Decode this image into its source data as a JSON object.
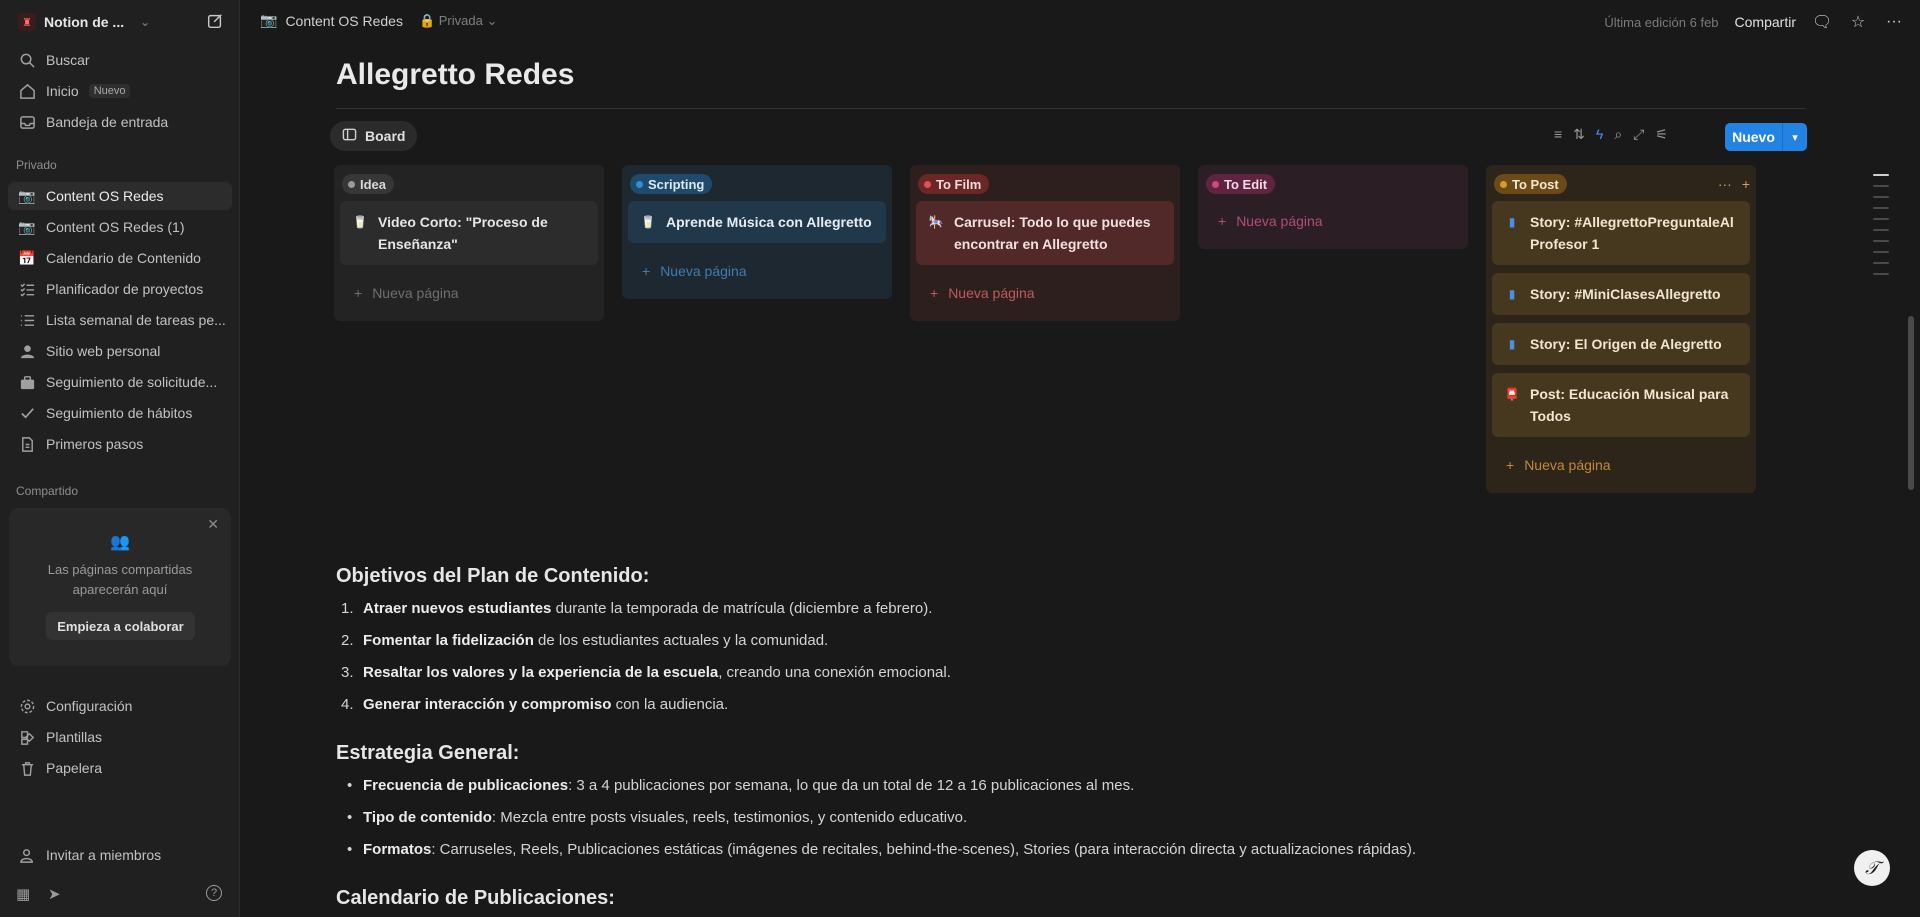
{
  "workspace": {
    "name": "Notion de ...",
    "avatar_glyph": "♜"
  },
  "sidebar": {
    "search": "Buscar",
    "home": "Inicio",
    "home_badge": "Nuevo",
    "inbox": "Bandeja de entrada",
    "private_label": "Privado",
    "private_items": [
      {
        "label": "Content OS Redes",
        "icon": "camera-icon"
      },
      {
        "label": "Content OS Redes (1)",
        "icon": "camera-icon"
      },
      {
        "label": "Calendario de Contenido",
        "icon": "calendar-icon"
      },
      {
        "label": "Planificador de proyectos",
        "icon": "checklist-icon"
      },
      {
        "label": "Lista semanal de tareas pe...",
        "icon": "list-icon"
      },
      {
        "label": "Sitio web personal",
        "icon": "person-icon"
      },
      {
        "label": "Seguimiento de solicitude...",
        "icon": "briefcase-icon"
      },
      {
        "label": "Seguimiento de hábitos",
        "icon": "check-icon"
      },
      {
        "label": "Primeros pasos",
        "icon": "document-icon"
      }
    ],
    "shared_label": "Compartido",
    "shared_card": {
      "text": "Las páginas compartidas aparecerán aquí",
      "button": "Empieza a colaborar"
    },
    "settings": "Configuración",
    "templates": "Plantillas",
    "trash": "Papelera",
    "invite": "Invitar a miembros"
  },
  "topbar": {
    "breadcrumb": "Content OS Redes",
    "privacy": "Privada",
    "edited": "Última edición 6 feb",
    "share": "Compartir"
  },
  "page": {
    "title": "Allegretto Redes",
    "view_tab": "Board",
    "new_button": "Nuevo"
  },
  "board": {
    "new_page_label": "Nueva página",
    "columns": [
      {
        "name": "Idea",
        "cards": [
          {
            "title": "Video Corto: \"Proceso de Enseñanza\"",
            "icon": "🥛"
          }
        ]
      },
      {
        "name": "Scripting",
        "cards": [
          {
            "title": "Aprende Música con Allegretto",
            "icon": "🥛"
          }
        ]
      },
      {
        "name": "To Film",
        "cards": [
          {
            "title": "Carrusel: Todo lo que puedes encontrar en Allegretto",
            "icon": "🎠"
          }
        ]
      },
      {
        "name": "To Edit",
        "cards": []
      },
      {
        "name": "To Post",
        "cards": [
          {
            "title": "Story: #AllegrettoPreguntaleAlProfesor 1",
            "icon": "▮"
          },
          {
            "title": "Story: #MiniClasesAllegretto",
            "icon": "▮"
          },
          {
            "title": "Story: El Origen de Alegretto",
            "icon": "▮"
          },
          {
            "title": "Post: Educación Musical para Todos",
            "icon": "📮"
          }
        ]
      }
    ]
  },
  "content": {
    "objectives_heading": "Objetivos del Plan de Contenido:",
    "objectives": [
      {
        "num": "1.",
        "bold": "Atraer nuevos estudiantes",
        "rest": " durante la temporada de matrícula (diciembre a febrero)."
      },
      {
        "num": "2.",
        "bold": "Fomentar la fidelización",
        "rest": " de los estudiantes actuales y la comunidad."
      },
      {
        "num": "3.",
        "bold": "Resaltar los valores y la experiencia de la escuela",
        "rest": ", creando una conexión emocional."
      },
      {
        "num": "4.",
        "bold": "Generar interacción y compromiso",
        "rest": " con la audiencia."
      }
    ],
    "strategy_heading": "Estrategia General:",
    "strategy": [
      {
        "bold": "Frecuencia de publicaciones",
        "rest": ": 3 a 4 publicaciones por semana, lo que da un total de 12 a 16 publicaciones al mes."
      },
      {
        "bold": "Tipo de contenido",
        "rest": ": Mezcla entre posts visuales, reels, testimonios, y contenido educativo."
      },
      {
        "bold": "Formatos",
        "rest": ": Carruseles, Reels, Publicaciones estáticas (imágenes de recitales, behind-the-scenes), Stories (para interacción directa y actualizaciones rápidas)."
      }
    ],
    "calendar_heading": "Calendario de Publicaciones:"
  },
  "colors": {
    "idea": "#9b9b9b",
    "scripting": "#2f8fd8",
    "tofilm": "#e05252",
    "toedit": "#d0487d",
    "topost": "#d99a2b",
    "accent": "#2383e2"
  }
}
